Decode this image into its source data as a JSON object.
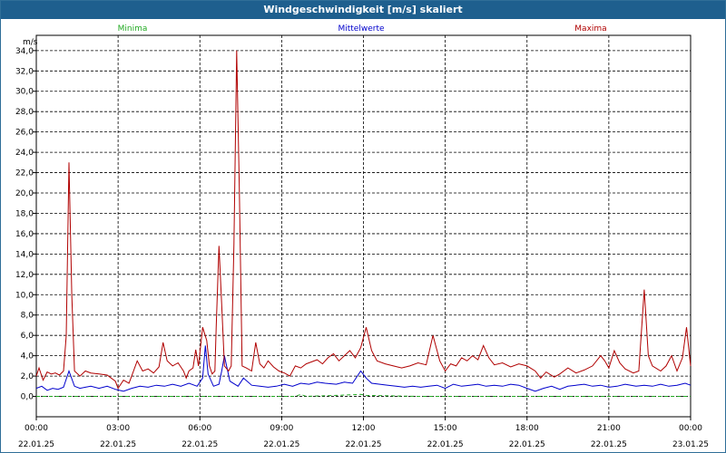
{
  "window": {
    "title": "Windgeschwindigkeit [m/s] skaliert"
  },
  "chart_data": {
    "type": "line",
    "title": "Windgeschwindigkeit [m/s] skaliert",
    "ylabel": "m/s",
    "ylim": [
      -2.0,
      35.5
    ],
    "xlim_hours": [
      0,
      24
    ],
    "yticks": [
      0,
      2,
      4,
      6,
      8,
      10,
      12,
      14,
      16,
      18,
      20,
      22,
      24,
      26,
      28,
      30,
      32,
      34
    ],
    "ytick_labels": [
      "0,0",
      "2,0",
      "4,0",
      "6,0",
      "8,0",
      "10,0",
      "12,0",
      "14,0",
      "16,0",
      "18,0",
      "20,0",
      "22,0",
      "24,0",
      "26,0",
      "28,0",
      "30,0",
      "32,0",
      "34,0"
    ],
    "xticks": [
      {
        "hour": 0,
        "time": "00:00",
        "date": "22.01.25"
      },
      {
        "hour": 3,
        "time": "03:00",
        "date": "22.01.25"
      },
      {
        "hour": 6,
        "time": "06:00",
        "date": "22.01.25"
      },
      {
        "hour": 9,
        "time": "09:00",
        "date": "22.01.25"
      },
      {
        "hour": 12,
        "time": "12:00",
        "date": "22.01.25"
      },
      {
        "hour": 15,
        "time": "15:00",
        "date": "22.01.25"
      },
      {
        "hour": 18,
        "time": "18:00",
        "date": "22.01.25"
      },
      {
        "hour": 21,
        "time": "21:00",
        "date": "22.01.25"
      },
      {
        "hour": 24,
        "time": "00:00",
        "date": "23.01.25"
      }
    ],
    "grid": true,
    "legend_position": "top",
    "series": [
      {
        "name": "Minima",
        "color": "#22aa22",
        "dashed": true,
        "points": [
          [
            0,
            0.0
          ],
          [
            2,
            0.0
          ],
          [
            4,
            0.0
          ],
          [
            6,
            0.0
          ],
          [
            8,
            0.0
          ],
          [
            9.5,
            0.0
          ],
          [
            9.7,
            0.2
          ],
          [
            9.9,
            0.0
          ],
          [
            11,
            0.1
          ],
          [
            11.9,
            0.2
          ],
          [
            12.1,
            0.1
          ],
          [
            14,
            0.0
          ],
          [
            18,
            0.0
          ],
          [
            21,
            0.0
          ],
          [
            24,
            0.0
          ]
        ]
      },
      {
        "name": "Mittelwerte",
        "color": "#0000cc",
        "dashed": false,
        "points": [
          [
            0,
            0.8
          ],
          [
            0.2,
            1.0
          ],
          [
            0.4,
            0.6
          ],
          [
            0.6,
            0.8
          ],
          [
            0.8,
            0.7
          ],
          [
            1,
            0.9
          ],
          [
            1.2,
            2.5
          ],
          [
            1.4,
            1.0
          ],
          [
            1.6,
            0.8
          ],
          [
            1.8,
            0.9
          ],
          [
            2,
            1.0
          ],
          [
            2.3,
            0.8
          ],
          [
            2.6,
            1.0
          ],
          [
            2.9,
            0.7
          ],
          [
            3.2,
            0.5
          ],
          [
            3.5,
            0.8
          ],
          [
            3.8,
            1.0
          ],
          [
            4.1,
            0.9
          ],
          [
            4.4,
            1.1
          ],
          [
            4.7,
            1.0
          ],
          [
            5,
            1.2
          ],
          [
            5.3,
            1.0
          ],
          [
            5.6,
            1.3
          ],
          [
            5.9,
            1.0
          ],
          [
            6.1,
            1.8
          ],
          [
            6.2,
            5.0
          ],
          [
            6.3,
            2.2
          ],
          [
            6.5,
            1.0
          ],
          [
            6.7,
            1.2
          ],
          [
            6.8,
            2.5
          ],
          [
            6.9,
            4.0
          ],
          [
            7.1,
            1.5
          ],
          [
            7.4,
            1.0
          ],
          [
            7.6,
            1.8
          ],
          [
            7.9,
            1.1
          ],
          [
            8.2,
            1.0
          ],
          [
            8.5,
            0.9
          ],
          [
            8.8,
            1.0
          ],
          [
            9.1,
            1.2
          ],
          [
            9.4,
            1.0
          ],
          [
            9.7,
            1.3
          ],
          [
            10,
            1.2
          ],
          [
            10.3,
            1.4
          ],
          [
            10.6,
            1.3
          ],
          [
            11,
            1.2
          ],
          [
            11.3,
            1.4
          ],
          [
            11.6,
            1.3
          ],
          [
            11.9,
            2.5
          ],
          [
            12.1,
            1.8
          ],
          [
            12.3,
            1.3
          ],
          [
            12.6,
            1.2
          ],
          [
            12.9,
            1.1
          ],
          [
            13.2,
            1.0
          ],
          [
            13.5,
            0.9
          ],
          [
            13.8,
            1.0
          ],
          [
            14.1,
            0.9
          ],
          [
            14.4,
            1.0
          ],
          [
            14.7,
            1.1
          ],
          [
            15,
            0.8
          ],
          [
            15.3,
            1.2
          ],
          [
            15.6,
            1.0
          ],
          [
            15.9,
            1.1
          ],
          [
            16.2,
            1.2
          ],
          [
            16.5,
            1.0
          ],
          [
            16.8,
            1.1
          ],
          [
            17.1,
            1.0
          ],
          [
            17.4,
            1.2
          ],
          [
            17.7,
            1.1
          ],
          [
            18,
            0.8
          ],
          [
            18.3,
            0.5
          ],
          [
            18.6,
            0.8
          ],
          [
            18.9,
            1.0
          ],
          [
            19.2,
            0.7
          ],
          [
            19.5,
            1.0
          ],
          [
            19.8,
            1.1
          ],
          [
            20.1,
            1.2
          ],
          [
            20.4,
            1.0
          ],
          [
            20.7,
            1.1
          ],
          [
            21,
            0.9
          ],
          [
            21.3,
            1.0
          ],
          [
            21.6,
            1.2
          ],
          [
            22,
            1.0
          ],
          [
            22.3,
            1.1
          ],
          [
            22.6,
            1.0
          ],
          [
            22.9,
            1.2
          ],
          [
            23.2,
            1.0
          ],
          [
            23.5,
            1.1
          ],
          [
            23.8,
            1.3
          ],
          [
            24,
            1.1
          ]
        ]
      },
      {
        "name": "Maxima",
        "color": "#b00000",
        "dashed": false,
        "points": [
          [
            0,
            2.0
          ],
          [
            0.1,
            2.8
          ],
          [
            0.25,
            1.6
          ],
          [
            0.4,
            2.4
          ],
          [
            0.55,
            2.2
          ],
          [
            0.7,
            2.3
          ],
          [
            0.85,
            2.1
          ],
          [
            1.0,
            2.5
          ],
          [
            1.1,
            6.0
          ],
          [
            1.2,
            23.0
          ],
          [
            1.3,
            10.0
          ],
          [
            1.4,
            2.5
          ],
          [
            1.6,
            2.0
          ],
          [
            1.8,
            2.5
          ],
          [
            2.0,
            2.3
          ],
          [
            2.3,
            2.2
          ],
          [
            2.6,
            2.1
          ],
          [
            2.9,
            1.5
          ],
          [
            3.0,
            0.8
          ],
          [
            3.2,
            1.6
          ],
          [
            3.4,
            1.3
          ],
          [
            3.5,
            2.0
          ],
          [
            3.7,
            3.5
          ],
          [
            3.9,
            2.5
          ],
          [
            4.1,
            2.7
          ],
          [
            4.3,
            2.3
          ],
          [
            4.5,
            2.9
          ],
          [
            4.65,
            5.3
          ],
          [
            4.8,
            3.5
          ],
          [
            5.0,
            3.0
          ],
          [
            5.2,
            3.3
          ],
          [
            5.4,
            2.5
          ],
          [
            5.5,
            1.8
          ],
          [
            5.6,
            2.5
          ],
          [
            5.75,
            2.8
          ],
          [
            5.85,
            4.6
          ],
          [
            5.95,
            3.0
          ],
          [
            6.1,
            6.8
          ],
          [
            6.25,
            5.5
          ],
          [
            6.35,
            3.0
          ],
          [
            6.45,
            2.2
          ],
          [
            6.55,
            2.5
          ],
          [
            6.6,
            7.0
          ],
          [
            6.7,
            14.8
          ],
          [
            6.8,
            9.0
          ],
          [
            6.9,
            3.0
          ],
          [
            7.05,
            2.5
          ],
          [
            7.15,
            3.0
          ],
          [
            7.25,
            15.0
          ],
          [
            7.35,
            34.0
          ],
          [
            7.45,
            20.0
          ],
          [
            7.55,
            3.0
          ],
          [
            7.7,
            2.8
          ],
          [
            7.9,
            2.5
          ],
          [
            8.05,
            5.3
          ],
          [
            8.2,
            3.2
          ],
          [
            8.35,
            2.8
          ],
          [
            8.5,
            3.5
          ],
          [
            8.7,
            2.9
          ],
          [
            8.9,
            2.5
          ],
          [
            9.1,
            2.3
          ],
          [
            9.3,
            2.0
          ],
          [
            9.5,
            3.0
          ],
          [
            9.7,
            2.8
          ],
          [
            9.9,
            3.2
          ],
          [
            10.1,
            3.4
          ],
          [
            10.3,
            3.6
          ],
          [
            10.5,
            3.2
          ],
          [
            10.7,
            3.8
          ],
          [
            10.9,
            4.2
          ],
          [
            11.1,
            3.5
          ],
          [
            11.3,
            4.0
          ],
          [
            11.5,
            4.5
          ],
          [
            11.7,
            3.8
          ],
          [
            11.9,
            4.8
          ],
          [
            12.1,
            6.8
          ],
          [
            12.3,
            4.5
          ],
          [
            12.5,
            3.5
          ],
          [
            12.8,
            3.2
          ],
          [
            13.1,
            3.0
          ],
          [
            13.4,
            2.8
          ],
          [
            13.7,
            3.0
          ],
          [
            14.0,
            3.3
          ],
          [
            14.3,
            3.1
          ],
          [
            14.55,
            6.0
          ],
          [
            14.8,
            3.5
          ],
          [
            15.0,
            2.5
          ],
          [
            15.2,
            3.2
          ],
          [
            15.4,
            3.0
          ],
          [
            15.6,
            3.8
          ],
          [
            15.8,
            3.5
          ],
          [
            16.0,
            4.0
          ],
          [
            16.2,
            3.6
          ],
          [
            16.4,
            5.0
          ],
          [
            16.6,
            3.8
          ],
          [
            16.8,
            3.1
          ],
          [
            17.1,
            3.3
          ],
          [
            17.4,
            2.9
          ],
          [
            17.7,
            3.2
          ],
          [
            18.0,
            3.0
          ],
          [
            18.3,
            2.5
          ],
          [
            18.5,
            1.8
          ],
          [
            18.7,
            2.4
          ],
          [
            19.0,
            1.9
          ],
          [
            19.2,
            2.2
          ],
          [
            19.5,
            2.8
          ],
          [
            19.8,
            2.3
          ],
          [
            20.1,
            2.6
          ],
          [
            20.4,
            3.0
          ],
          [
            20.7,
            4.0
          ],
          [
            20.85,
            3.5
          ],
          [
            21.0,
            2.8
          ],
          [
            21.2,
            4.5
          ],
          [
            21.4,
            3.3
          ],
          [
            21.6,
            2.7
          ],
          [
            21.9,
            2.3
          ],
          [
            22.1,
            2.5
          ],
          [
            22.3,
            10.5
          ],
          [
            22.45,
            4.0
          ],
          [
            22.6,
            3.0
          ],
          [
            22.9,
            2.5
          ],
          [
            23.1,
            3.0
          ],
          [
            23.3,
            4.0
          ],
          [
            23.5,
            2.5
          ],
          [
            23.7,
            3.8
          ],
          [
            23.85,
            6.8
          ],
          [
            24.0,
            3.0
          ]
        ]
      }
    ]
  }
}
